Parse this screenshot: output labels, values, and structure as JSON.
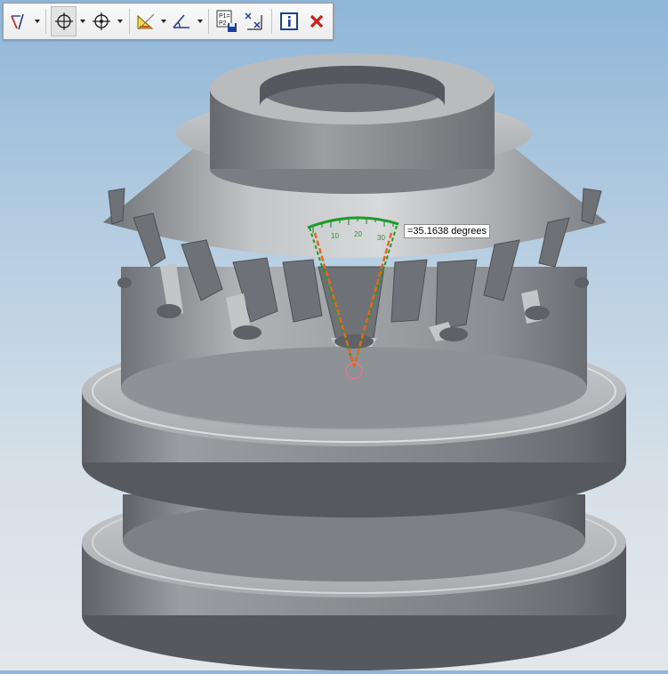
{
  "toolbar": {
    "buttons": [
      {
        "icon": "line-angle-icon",
        "has_dropdown": true
      },
      {
        "icon": "crosshair-point-icon",
        "has_dropdown": true,
        "pressed": true
      },
      {
        "icon": "crosshair-center-icon",
        "has_dropdown": true
      },
      {
        "icon": "ruler-measure-icon",
        "has_dropdown": true
      },
      {
        "icon": "angle-measure-icon",
        "has_dropdown": true
      },
      {
        "icon": "p1-p2-save-icon",
        "label": "P1=\nP2"
      },
      {
        "icon": "point-distance-icon"
      },
      {
        "icon": "info-icon",
        "label": "i"
      },
      {
        "icon": "close-icon",
        "color": "#c8201c"
      }
    ]
  },
  "measurement": {
    "readout": "=35.1638 degrees",
    "scale_ticks": [
      "10",
      "20",
      "30"
    ],
    "value_degrees": 35.1638
  },
  "colors": {
    "protractor_green": "#1f9a2a",
    "guide_orange": "#e8661a",
    "pick_circle": "#e07a8a",
    "model_gray": "#8f9296"
  }
}
